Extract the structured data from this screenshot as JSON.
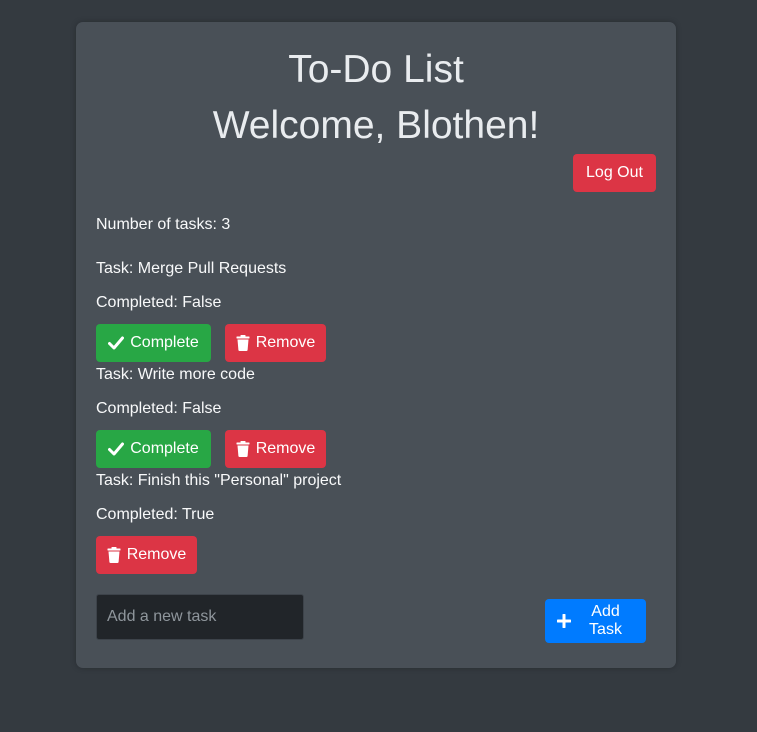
{
  "header": {
    "title": "To-Do List",
    "welcome": "Welcome, Blothen!",
    "logout_label": "Log Out"
  },
  "summary": {
    "count_text": "Number of tasks: 3"
  },
  "tasks": [
    {
      "task_text": "Task: Merge Pull Requests",
      "completed_text": "Completed: False",
      "complete_label": "Complete",
      "remove_label": "Remove"
    },
    {
      "task_text": "Task: Write more code",
      "completed_text": "Completed: False",
      "complete_label": "Complete",
      "remove_label": "Remove"
    },
    {
      "task_text": "Task: Finish this \"Personal\" project",
      "completed_text": "Completed: True",
      "remove_label": "Remove"
    }
  ],
  "new_task": {
    "placeholder": "Add a new task",
    "value": "",
    "add_label": "Add Task"
  },
  "icons": {
    "check": "check-icon",
    "trash": "trash-icon",
    "plus": "plus-icon"
  },
  "colors": {
    "page_bg": "#343a40",
    "card_bg": "#495057",
    "danger": "#dc3545",
    "success": "#28a745",
    "primary": "#007bff",
    "input_bg": "#212529"
  }
}
